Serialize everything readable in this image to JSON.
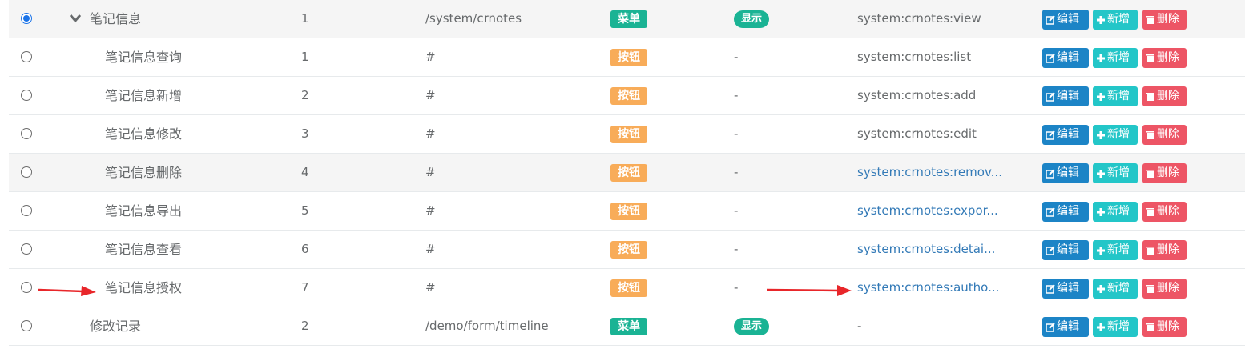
{
  "actions": {
    "edit": "编辑",
    "add": "新增",
    "delete": "删除"
  },
  "colors": {
    "menu_badge": "#1ab394",
    "button_badge": "#f8ac59",
    "visible_badge": "#1ab394",
    "edit_button": "#1c84c6",
    "add_button": "#23c6c8",
    "delete_button": "#ed5565",
    "link": "#337ab7",
    "annotation_arrow": "#e8262a"
  },
  "rows": [
    {
      "name": "笔记信息",
      "order": "1",
      "url": "/system/crnotes",
      "type": "菜单",
      "visible": "显示",
      "perm": "system:crnotes:view",
      "selected": true,
      "expanded": true
    },
    {
      "name": "笔记信息查询",
      "order": "1",
      "url": "#",
      "type": "按钮",
      "visible": "-",
      "perm": "system:crnotes:list"
    },
    {
      "name": "笔记信息新增",
      "order": "2",
      "url": "#",
      "type": "按钮",
      "visible": "-",
      "perm": "system:crnotes:add"
    },
    {
      "name": "笔记信息修改",
      "order": "3",
      "url": "#",
      "type": "按钮",
      "visible": "-",
      "perm": "system:crnotes:edit"
    },
    {
      "name": "笔记信息删除",
      "order": "4",
      "url": "#",
      "type": "按钮",
      "visible": "-",
      "perm": "system:crnotes:remov..."
    },
    {
      "name": "笔记信息导出",
      "order": "5",
      "url": "#",
      "type": "按钮",
      "visible": "-",
      "perm": "system:crnotes:expor..."
    },
    {
      "name": "笔记信息查看",
      "order": "6",
      "url": "#",
      "type": "按钮",
      "visible": "-",
      "perm": "system:crnotes:detai..."
    },
    {
      "name": "笔记信息授权",
      "order": "7",
      "url": "#",
      "type": "按钮",
      "visible": "-",
      "perm": "system:crnotes:autho..."
    },
    {
      "name": "修改记录",
      "order": "2",
      "url": "/demo/form/timeline",
      "type": "菜单",
      "visible": "显示",
      "perm": "-"
    }
  ]
}
